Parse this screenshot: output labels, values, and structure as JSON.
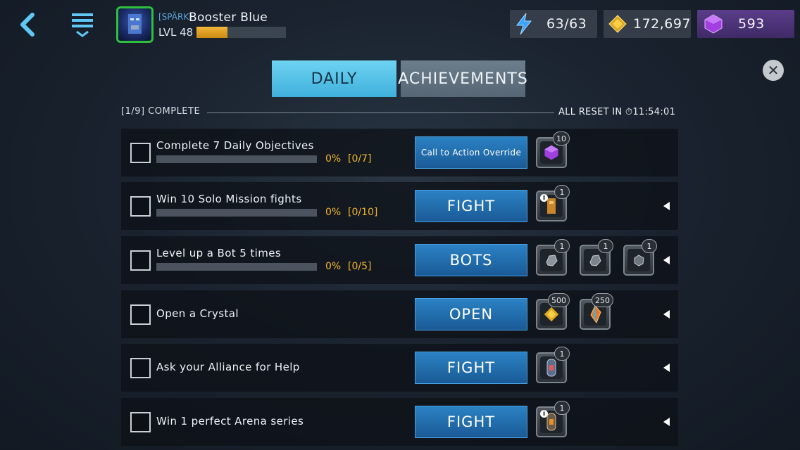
{
  "header": {
    "player_tag": "[SPÄRK]",
    "player_name": "Booster Blue",
    "level_label": "LVL 48",
    "xp_fraction": 0.35,
    "energy": "63/63",
    "gold": "172,697",
    "gems": "593"
  },
  "tabs": [
    {
      "label": "DAILY",
      "active": true
    },
    {
      "label": "ACHIEVEMENTS",
      "active": false
    }
  ],
  "summary": {
    "complete_label": "[1/9] COMPLETE",
    "reset_label": "ALL RESET IN",
    "reset_time": "11:54:01"
  },
  "objectives": [
    {
      "title": "Complete 7 Daily Objectives",
      "percent": "0%",
      "count": "[0/7]",
      "action": "Call to Action Override",
      "rewards": [
        {
          "icon": "gem-icon",
          "qty": "10"
        }
      ],
      "has_arrow": false
    },
    {
      "title": "Win 10 Solo Mission fights",
      "percent": "0%",
      "count": "[0/10]",
      "action": "FIGHT",
      "rewards": [
        {
          "icon": "bot-crate-icon",
          "qty": "1"
        }
      ],
      "has_arrow": true
    },
    {
      "title": "Level up a Bot 5 times",
      "percent": "0%",
      "count": "[0/5]",
      "action": "BOTS",
      "rewards": [
        {
          "icon": "ore-icon",
          "qty": "1"
        },
        {
          "icon": "ore-icon",
          "qty": "1"
        },
        {
          "icon": "ore-icon",
          "qty": "1"
        }
      ],
      "has_arrow": true
    },
    {
      "title": "Open a Crystal",
      "percent": "",
      "count": "",
      "action": "OPEN",
      "rewards": [
        {
          "icon": "gold-icon",
          "qty": "500"
        },
        {
          "icon": "shard-icon",
          "qty": "250"
        }
      ],
      "has_arrow": true
    },
    {
      "title": "Ask your Alliance for Help",
      "percent": "",
      "count": "",
      "action": "FIGHT",
      "rewards": [
        {
          "icon": "capsule-icon",
          "qty": "1"
        }
      ],
      "has_arrow": true
    },
    {
      "title": "Win 1 perfect Arena series",
      "percent": "",
      "count": "",
      "action": "FIGHT",
      "rewards": [
        {
          "icon": "capsule-icon",
          "qty": "1"
        }
      ],
      "has_arrow": true
    }
  ],
  "colors": {
    "accent": "#3fb0dc",
    "progress_text": "#f0b42a",
    "button": "#1a5a96"
  }
}
